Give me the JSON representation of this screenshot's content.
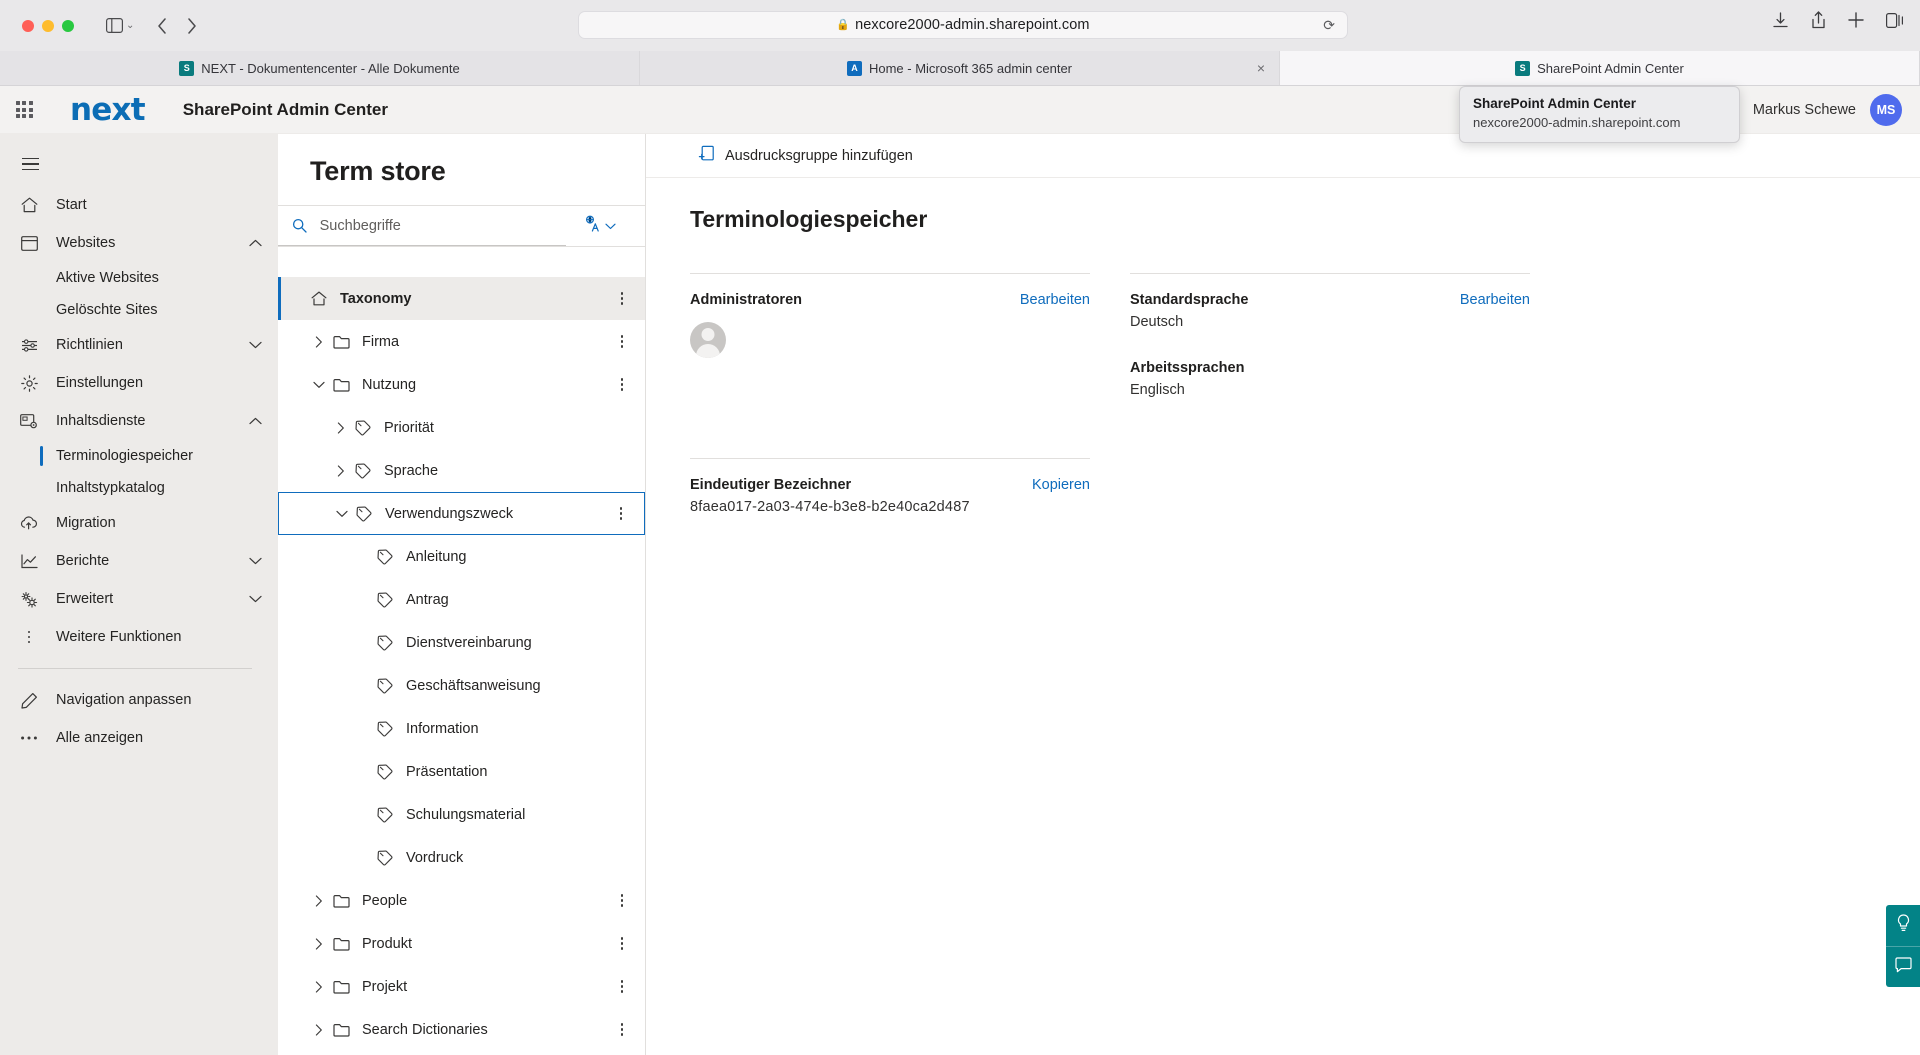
{
  "browser": {
    "url": "nexcore2000-admin.sharepoint.com",
    "lock_icon": "lock-icon",
    "reload_icon": "reload-icon",
    "back_icon": "chevron-left-icon",
    "forward_icon": "chevron-right-icon",
    "sidebar_icon": "sidebar-toggle-icon",
    "shield_icon": "shield-icon",
    "download_icon": "download-icon",
    "share_icon": "share-icon",
    "newtab_icon": "plus-icon",
    "tabs_overview_icon": "tabs-overview-icon",
    "tabs": [
      {
        "label": "NEXT - Dokumentencenter - Alle Dokumente",
        "favicon": "sharepoint-icon",
        "favicon_letter": "S",
        "active": false,
        "closable": false
      },
      {
        "label": "Home - Microsoft 365 admin center",
        "favicon": "m365-admin-icon",
        "favicon_letter": "A",
        "active": false,
        "closable": true
      },
      {
        "label": "SharePoint Admin Center",
        "favicon": "sharepoint-icon",
        "favicon_letter": "S",
        "active": true,
        "closable": false
      }
    ],
    "tooltip": {
      "title": "SharePoint Admin Center",
      "url": "nexcore2000-admin.sharepoint.com"
    }
  },
  "app_header": {
    "waffle_icon": "app-launcher-icon",
    "brand": "next",
    "title": "SharePoint Admin Center",
    "user_name": "Markus Schewe",
    "user_initials": "MS"
  },
  "left_nav": {
    "hamburger_icon": "hamburger-menu-icon",
    "items": [
      {
        "label": "Start",
        "icon": "home-icon",
        "type": "item",
        "chevron": ""
      },
      {
        "label": "Websites",
        "icon": "sites-icon",
        "type": "item",
        "chevron": "up"
      },
      {
        "label": "Aktive Websites",
        "icon": "",
        "type": "sub",
        "selected": false
      },
      {
        "label": "Gelöschte Sites",
        "icon": "",
        "type": "sub",
        "selected": false
      },
      {
        "label": "Richtlinien",
        "icon": "policies-icon",
        "type": "item",
        "chevron": "down"
      },
      {
        "label": "Einstellungen",
        "icon": "gear-icon",
        "type": "item",
        "chevron": ""
      },
      {
        "label": "Inhaltsdienste",
        "icon": "content-services-icon",
        "type": "item",
        "chevron": "up"
      },
      {
        "label": "Terminologiespeicher",
        "icon": "",
        "type": "sub",
        "selected": true
      },
      {
        "label": "Inhaltstypkatalog",
        "icon": "",
        "type": "sub",
        "selected": false
      },
      {
        "label": "Migration",
        "icon": "migration-cloud-icon",
        "type": "item",
        "chevron": ""
      },
      {
        "label": "Berichte",
        "icon": "reports-chart-icon",
        "type": "item",
        "chevron": "down"
      },
      {
        "label": "Erweitert",
        "icon": "advanced-gears-icon",
        "type": "item",
        "chevron": "down"
      },
      {
        "label": "Weitere Funktionen",
        "icon": "more-dots-icon",
        "type": "item",
        "chevron": ""
      }
    ],
    "footer_items": [
      {
        "label": "Navigation anpassen",
        "icon": "pencil-icon"
      },
      {
        "label": "Alle anzeigen",
        "icon": "ellipsis-icon"
      }
    ]
  },
  "term_store": {
    "title": "Term store",
    "search_placeholder": "Suchbegriffe",
    "search_value": "",
    "search_icon": "search-icon",
    "language_filter_icon": "language-translate-icon",
    "language_filter_chevron": "chevron-down-icon",
    "tree": [
      {
        "label": "Taxonomy",
        "icon": "home-icon",
        "indent": 0,
        "expander": "none",
        "state": "root",
        "more": true
      },
      {
        "label": "Firma",
        "icon": "folder-icon",
        "indent": 1,
        "expander": "collapsed",
        "state": "normal",
        "more": true
      },
      {
        "label": "Nutzung",
        "icon": "folder-icon",
        "indent": 1,
        "expander": "expanded",
        "state": "normal",
        "more": true
      },
      {
        "label": "Priorität",
        "icon": "tag-icon",
        "indent": 2,
        "expander": "collapsed",
        "state": "normal",
        "more": false
      },
      {
        "label": "Sprache",
        "icon": "tag-icon",
        "indent": 2,
        "expander": "collapsed",
        "state": "normal",
        "more": false
      },
      {
        "label": "Verwendungszweck",
        "icon": "tag-icon",
        "indent": 2,
        "expander": "expanded",
        "state": "selected",
        "more": true
      },
      {
        "label": "Anleitung",
        "icon": "tag-icon",
        "indent": 3,
        "expander": "none",
        "state": "normal",
        "more": false
      },
      {
        "label": "Antrag",
        "icon": "tag-icon",
        "indent": 3,
        "expander": "none",
        "state": "normal",
        "more": false
      },
      {
        "label": "Dienstvereinbarung",
        "icon": "tag-icon",
        "indent": 3,
        "expander": "none",
        "state": "normal",
        "more": false
      },
      {
        "label": "Geschäftsanweisung",
        "icon": "tag-icon",
        "indent": 3,
        "expander": "none",
        "state": "normal",
        "more": false
      },
      {
        "label": "Information",
        "icon": "tag-icon",
        "indent": 3,
        "expander": "none",
        "state": "normal",
        "more": false
      },
      {
        "label": "Präsentation",
        "icon": "tag-icon",
        "indent": 3,
        "expander": "none",
        "state": "normal",
        "more": false
      },
      {
        "label": "Schulungsmaterial",
        "icon": "tag-icon",
        "indent": 3,
        "expander": "none",
        "state": "normal",
        "more": false
      },
      {
        "label": "Vordruck",
        "icon": "tag-icon",
        "indent": 3,
        "expander": "none",
        "state": "normal",
        "more": false
      },
      {
        "label": "People",
        "icon": "folder-icon",
        "indent": 1,
        "expander": "collapsed",
        "state": "normal",
        "more": true
      },
      {
        "label": "Produkt",
        "icon": "folder-icon",
        "indent": 1,
        "expander": "collapsed",
        "state": "normal",
        "more": true
      },
      {
        "label": "Projekt",
        "icon": "folder-icon",
        "indent": 1,
        "expander": "collapsed",
        "state": "normal",
        "more": true
      },
      {
        "label": "Search Dictionaries",
        "icon": "folder-icon",
        "indent": 1,
        "expander": "collapsed",
        "state": "normal",
        "more": true
      }
    ]
  },
  "detail": {
    "command_label": "Ausdrucksgruppe hinzufügen",
    "command_icon": "add-term-group-icon",
    "heading": "Terminologiespeicher",
    "administrators": {
      "label": "Administratoren",
      "edit_link": "Bearbeiten",
      "persona_icon": "person-avatar-icon"
    },
    "default_language": {
      "label": "Standardsprache",
      "edit_link": "Bearbeiten",
      "value": "Deutsch"
    },
    "working_languages": {
      "label": "Arbeitssprachen",
      "value": "Englisch"
    },
    "unique_identifier": {
      "label": "Eindeutiger Bezeichner",
      "copy_link": "Kopieren",
      "value": "8faea017-2a03-474e-b3e8-b2e40ca2d487"
    }
  },
  "feedback_rail": {
    "help_icon": "lightbulb-icon",
    "feedback_icon": "feedback-chat-icon"
  },
  "colors": {
    "accent": "#0f6cbd",
    "brand_blue": "#0b6db5",
    "teal": "#038387",
    "nav_bg": "#edebe9"
  }
}
